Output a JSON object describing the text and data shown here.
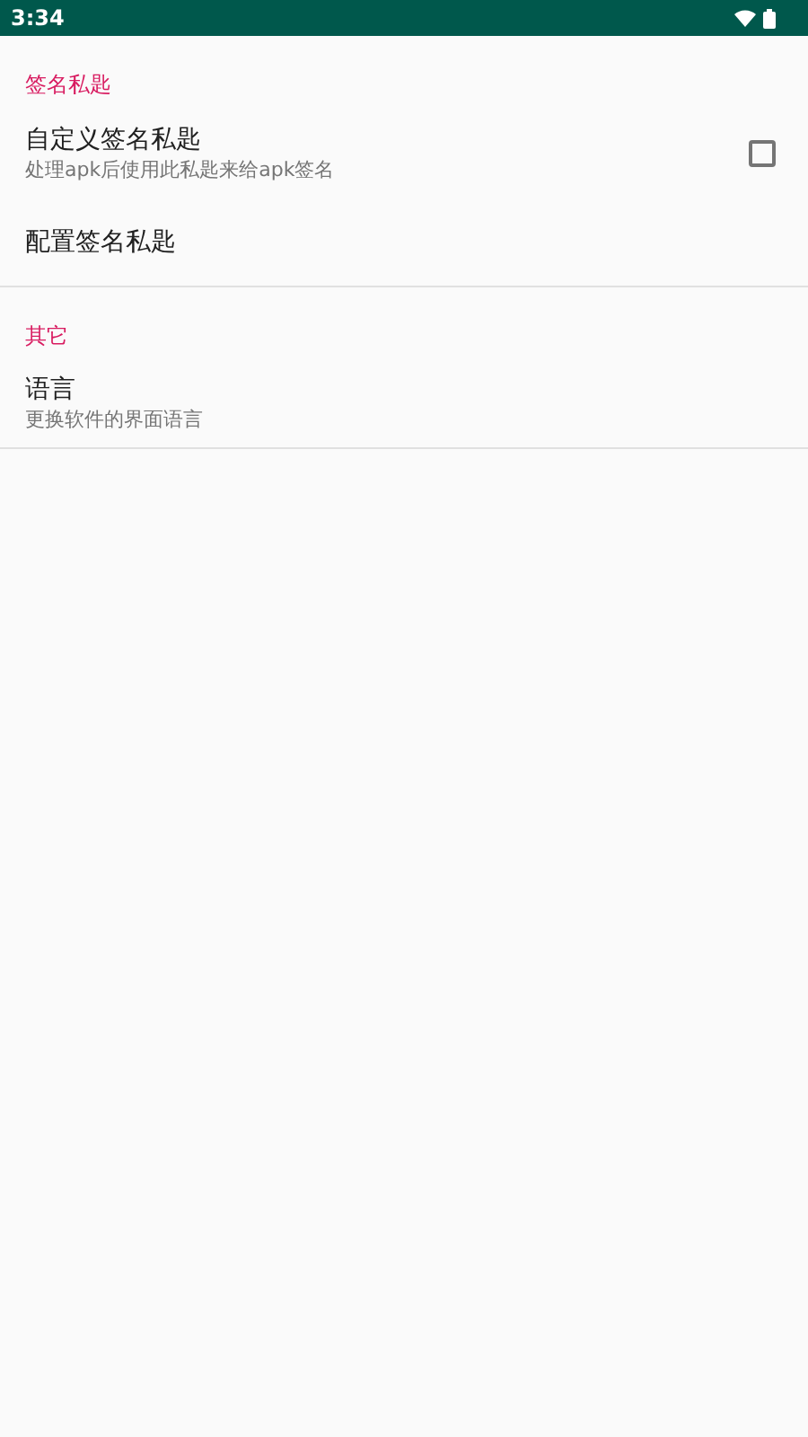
{
  "status_bar": {
    "time": "3:34"
  },
  "sections": [
    {
      "title": "签名私匙",
      "items": [
        {
          "kind": "checkbox",
          "title": "自定义签名私匙",
          "summary": "处理apk后使用此私匙来给apk签名",
          "checked": false
        },
        {
          "kind": "plain",
          "title": "配置签名私匙"
        }
      ]
    },
    {
      "title": "其它",
      "items": [
        {
          "kind": "plain",
          "title": "语言",
          "summary": "更换软件的界面语言"
        }
      ]
    }
  ]
}
